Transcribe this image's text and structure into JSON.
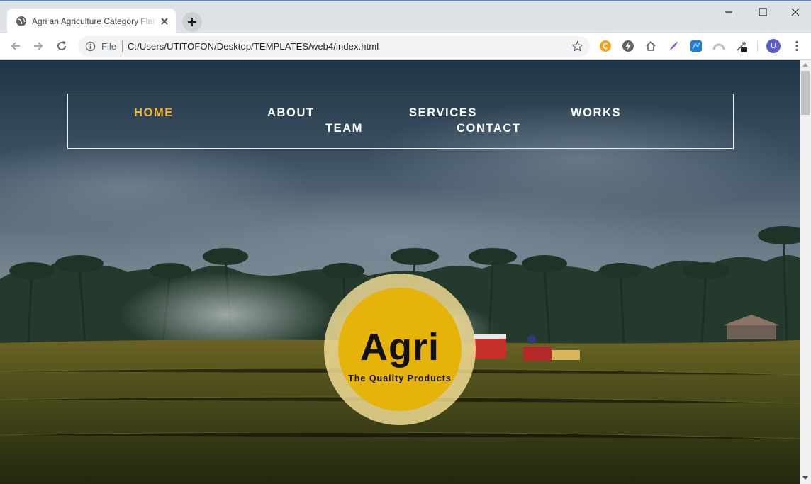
{
  "browser": {
    "tab_title": "Agri an Agriculture Category Flat Bootstrap Responsive Web Template",
    "omnibox_scheme": "File",
    "url": "C:/Users/UTITOFON/Desktop/TEMPLATES/web4/index.html",
    "avatar_initial": "U",
    "ext_badge": "-",
    "icons": [
      "globe-icon",
      "close-icon",
      "plus-icon",
      "back-arrow-icon",
      "forward-arrow-icon",
      "reload-icon",
      "info-icon",
      "star-icon",
      "extension-icons",
      "kebab-menu-icon"
    ]
  },
  "nav": {
    "items": [
      {
        "label": "HOME",
        "active": true
      },
      {
        "label": "ABOUT",
        "active": false
      },
      {
        "label": "SERVICES",
        "active": false
      },
      {
        "label": "WORKS",
        "active": false
      },
      {
        "label": "TEAM",
        "active": false
      },
      {
        "label": "CONTACT",
        "active": false
      }
    ]
  },
  "logo": {
    "title": "Agri",
    "tagline": "The Quality Products"
  },
  "colors": {
    "accent": "#f5b82e",
    "logo_disc": "#e6b30a",
    "logo_ring": "#ffe89e",
    "nav_text": "#ffffff"
  }
}
